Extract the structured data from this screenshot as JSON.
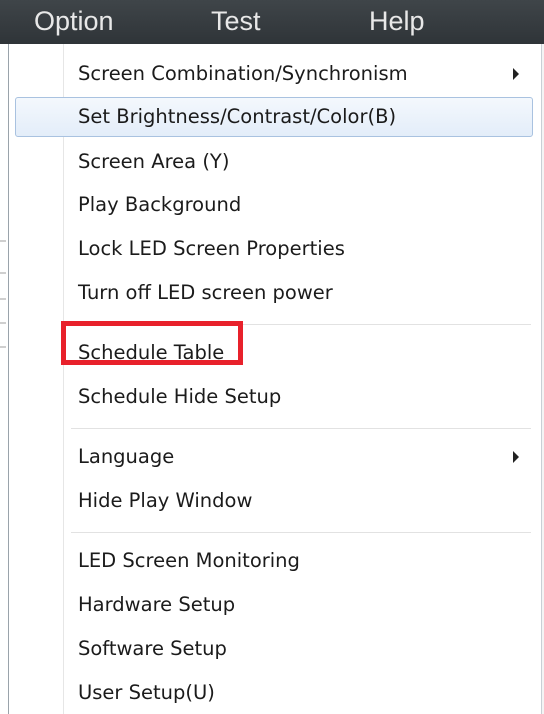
{
  "menubar": {
    "items": [
      {
        "label": "Option"
      },
      {
        "label": "Test"
      },
      {
        "label": "Help"
      }
    ]
  },
  "option_menu": {
    "items": [
      {
        "label": "Screen Combination/Synchronism",
        "has_submenu": true
      },
      {
        "label": "Set Brightness/Contrast/Color(B)",
        "hovered": true
      },
      {
        "label": "Screen Area (Y)"
      },
      {
        "label": "Play Background"
      },
      {
        "label": "Lock LED Screen Properties"
      },
      {
        "label": "Turn off LED screen power"
      },
      {
        "label": "Schedule Table",
        "highlighted": true
      },
      {
        "label": "Schedule Hide Setup"
      },
      {
        "label": "Language",
        "has_submenu": true
      },
      {
        "label": "Hide Play Window"
      },
      {
        "label": "LED Screen Monitoring"
      },
      {
        "label": "Hardware Setup"
      },
      {
        "label": "Software Setup"
      },
      {
        "label": "User Setup(U)"
      }
    ]
  },
  "colors": {
    "menubar_bg": "#373d41",
    "menubar_text": "#e8e8e8",
    "hover_border": "#a9c2e0",
    "highlight_annotation": "#e8212b"
  },
  "icons": {
    "submenu": "chevron-right-icon"
  }
}
